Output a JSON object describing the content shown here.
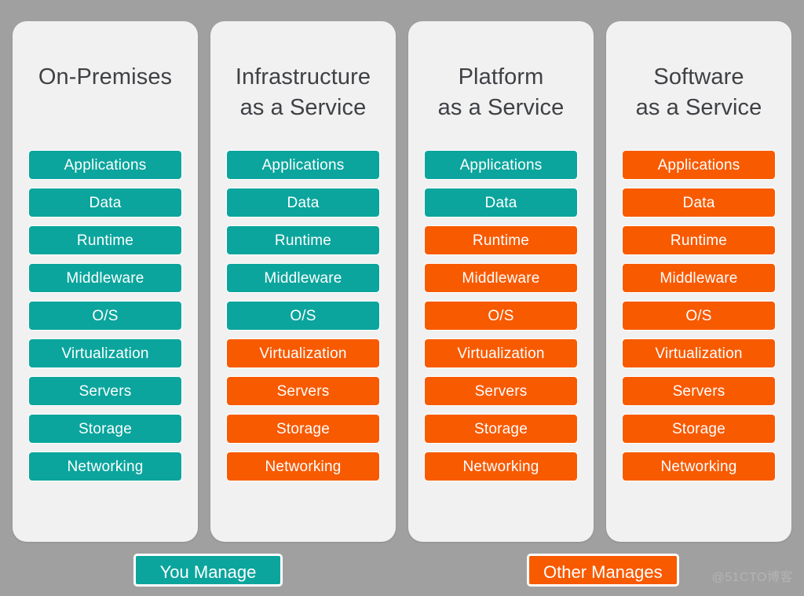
{
  "diagram": {
    "title_lines_separator": " ",
    "background_color": "#a0a0a0",
    "card_color": "#f1f1f1",
    "colors": {
      "you_manage": "#0ba59d",
      "other_manages": "#f85a00",
      "label_text": "#ffffff",
      "title_text": "#3f4145"
    },
    "layer_names": [
      "Applications",
      "Data",
      "Runtime",
      "Middleware",
      "O/S",
      "Virtualization",
      "Servers",
      "Storage",
      "Networking"
    ],
    "columns": [
      {
        "id": "on-premises",
        "title_line1": "On-Premises",
        "title_line2": "",
        "layers": [
          {
            "label": "Applications",
            "owner": "you"
          },
          {
            "label": "Data",
            "owner": "you"
          },
          {
            "label": "Runtime",
            "owner": "you"
          },
          {
            "label": "Middleware",
            "owner": "you"
          },
          {
            "label": "O/S",
            "owner": "you"
          },
          {
            "label": "Virtualization",
            "owner": "you"
          },
          {
            "label": "Servers",
            "owner": "you"
          },
          {
            "label": "Storage",
            "owner": "you"
          },
          {
            "label": "Networking",
            "owner": "you"
          }
        ]
      },
      {
        "id": "infrastructure-as-a-service",
        "title_line1": "Infrastructure",
        "title_line2": "as a Service",
        "layers": [
          {
            "label": "Applications",
            "owner": "you"
          },
          {
            "label": "Data",
            "owner": "you"
          },
          {
            "label": "Runtime",
            "owner": "you"
          },
          {
            "label": "Middleware",
            "owner": "you"
          },
          {
            "label": "O/S",
            "owner": "you"
          },
          {
            "label": "Virtualization",
            "owner": "other"
          },
          {
            "label": "Servers",
            "owner": "other"
          },
          {
            "label": "Storage",
            "owner": "other"
          },
          {
            "label": "Networking",
            "owner": "other"
          }
        ]
      },
      {
        "id": "platform-as-a-service",
        "title_line1": "Platform",
        "title_line2": "as a Service",
        "layers": [
          {
            "label": "Applications",
            "owner": "you"
          },
          {
            "label": "Data",
            "owner": "you"
          },
          {
            "label": "Runtime",
            "owner": "other"
          },
          {
            "label": "Middleware",
            "owner": "other"
          },
          {
            "label": "O/S",
            "owner": "other"
          },
          {
            "label": "Virtualization",
            "owner": "other"
          },
          {
            "label": "Servers",
            "owner": "other"
          },
          {
            "label": "Storage",
            "owner": "other"
          },
          {
            "label": "Networking",
            "owner": "other"
          }
        ]
      },
      {
        "id": "software-as-a-service",
        "title_line1": "Software",
        "title_line2": "as a Service",
        "layers": [
          {
            "label": "Applications",
            "owner": "other"
          },
          {
            "label": "Data",
            "owner": "other"
          },
          {
            "label": "Runtime",
            "owner": "other"
          },
          {
            "label": "Middleware",
            "owner": "other"
          },
          {
            "label": "O/S",
            "owner": "other"
          },
          {
            "label": "Virtualization",
            "owner": "other"
          },
          {
            "label": "Servers",
            "owner": "other"
          },
          {
            "label": "Storage",
            "owner": "other"
          },
          {
            "label": "Networking",
            "owner": "other"
          }
        ]
      }
    ],
    "legend": {
      "you_manage_label": "You Manage",
      "other_manages_label": "Other Manages"
    },
    "watermark": "@51CTO博客"
  }
}
